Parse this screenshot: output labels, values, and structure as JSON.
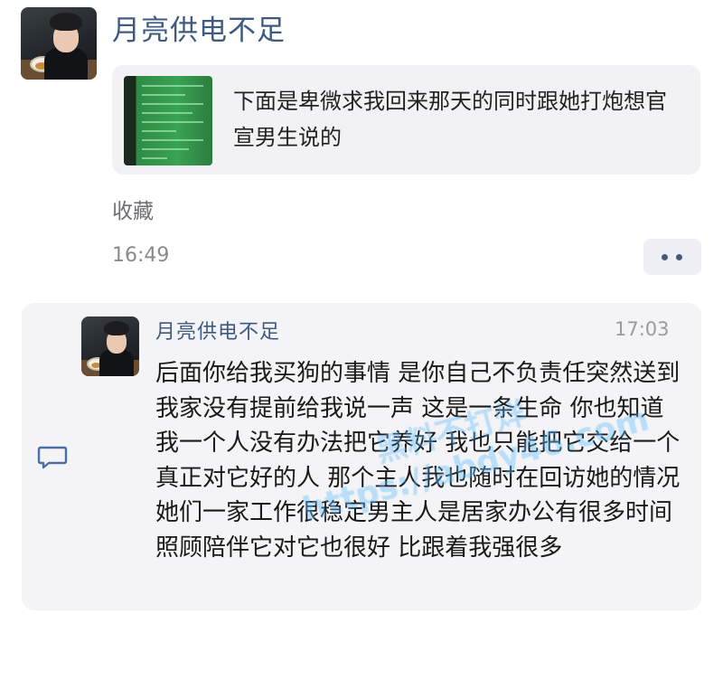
{
  "top_message": {
    "sender_name": "月亮供电不足",
    "forwarded_text": "下面是卑微求我回来那天的同时跟她打炮想官宣男生说的",
    "collect_label": "收藏",
    "time": "16:49",
    "more_icon": "more-dots-icon"
  },
  "chat_record": {
    "sender_name": "月亮供电不足",
    "time": "17:03",
    "body": "后面你给我买狗的事情 是你自己不负责任突然送到我家没有提前给我说一声 这是一条生命 你也知道我一个人没有办法把它养好 我也只能把它交给一个真正对它好的人 那个主人我也随时在回访她的情况她们一家工作很稳定男主人是居家办公有很多时间照顾陪伴它对它也很好 比跟着我强很多",
    "chat_icon": "chat-bubble-icon"
  },
  "watermark": {
    "line1": "黑料不打烊",
    "line2": "https://abdy46.com"
  },
  "colors": {
    "name_blue": "#3d5a80",
    "card_bg": "#f2f2f4",
    "muted_text": "#8a8a8e"
  }
}
